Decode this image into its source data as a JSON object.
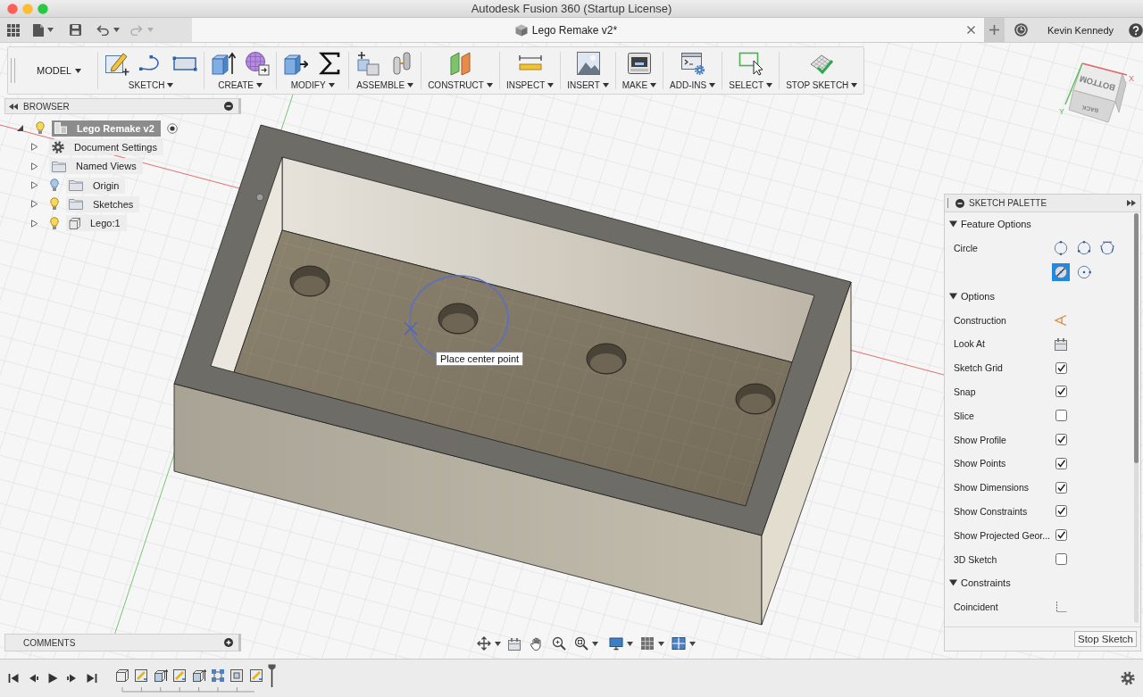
{
  "window": {
    "title": "Autodesk Fusion 360 (Startup License)"
  },
  "quick_access": {
    "undo": {
      "disabled": false
    },
    "redo": {
      "disabled": true
    }
  },
  "document_tab": {
    "title": "Lego Remake v2*"
  },
  "account": {
    "user": "Kevin Kennedy"
  },
  "toolbar": {
    "workspace": "MODEL",
    "groups": [
      {
        "label": "SKETCH"
      },
      {
        "label": "CREATE"
      },
      {
        "label": "MODIFY"
      },
      {
        "label": "ASSEMBLE"
      },
      {
        "label": "CONSTRUCT"
      },
      {
        "label": "INSPECT"
      },
      {
        "label": "INSERT"
      },
      {
        "label": "MAKE"
      },
      {
        "label": "ADD-INS"
      },
      {
        "label": "SELECT"
      },
      {
        "label": "STOP SKETCH"
      }
    ]
  },
  "browser": {
    "title": "BROWSER",
    "root": {
      "label": "Lego Remake v2",
      "kind": "component",
      "expanded": true,
      "selected": true,
      "visible": true,
      "active": true,
      "children": [
        {
          "label": "Document Settings",
          "kind": "settings",
          "expanded": false,
          "selected": false
        },
        {
          "label": "Named Views",
          "kind": "folder",
          "expanded": false,
          "selected": false
        },
        {
          "label": "Origin",
          "kind": "folder",
          "expanded": false,
          "selected": false,
          "visible": false
        },
        {
          "label": "Sketches",
          "kind": "folder",
          "expanded": false,
          "selected": false,
          "visible": true
        },
        {
          "label": "Lego:1",
          "kind": "body",
          "expanded": false,
          "selected": false,
          "visible": true
        }
      ]
    }
  },
  "viewport": {
    "view_cube": {
      "faces": [
        "BOTTOM",
        "BACK"
      ],
      "axes": [
        "X",
        "Y"
      ]
    },
    "tooltip": "Place center point"
  },
  "sketch_palette": {
    "title": "SKETCH PALETTE",
    "sections": [
      {
        "title": "Feature Options",
        "expanded": true,
        "rows": [
          {
            "kind": "circle",
            "label": "Circle",
            "options": [
              {
                "selected": false
              },
              {
                "selected": false
              },
              {
                "selected": false
              },
              {
                "selected": true
              },
              {
                "selected": false
              }
            ]
          }
        ]
      },
      {
        "title": "Options",
        "expanded": true,
        "rows": [
          {
            "kind": "construction",
            "label": "Construction"
          },
          {
            "kind": "lookat",
            "label": "Look At"
          },
          {
            "kind": "checkbox",
            "label": "Sketch Grid",
            "checked": true
          },
          {
            "kind": "checkbox",
            "label": "Snap",
            "checked": true
          },
          {
            "kind": "checkbox",
            "label": "Slice",
            "checked": false
          },
          {
            "kind": "checkbox",
            "label": "Show Profile",
            "checked": true
          },
          {
            "kind": "checkbox",
            "label": "Show Points",
            "checked": true
          },
          {
            "kind": "checkbox",
            "label": "Show Dimensions",
            "checked": true
          },
          {
            "kind": "checkbox",
            "label": "Show Constraints",
            "checked": true
          },
          {
            "kind": "checkbox",
            "label": "Show Projected Geor...",
            "checked": true
          },
          {
            "kind": "checkbox",
            "label": "3D Sketch",
            "checked": false
          }
        ]
      },
      {
        "title": "Constraints",
        "expanded": true,
        "rows": [
          {
            "kind": "coincident",
            "label": "Coincident"
          }
        ]
      }
    ],
    "button": "Stop Sketch"
  },
  "comments": {
    "title": "COMMENTS"
  }
}
